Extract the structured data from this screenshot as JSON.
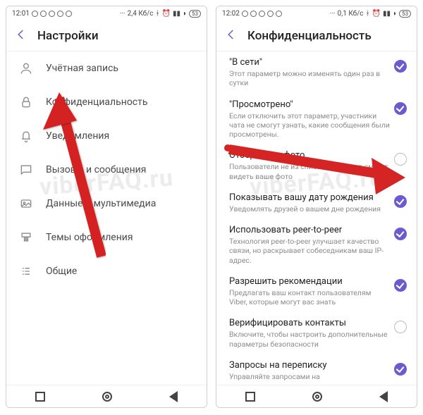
{
  "watermark": "viberFAQ.ru",
  "left": {
    "status": {
      "time": "12:01",
      "net": "2,4 Кб/с",
      "batt": "53"
    },
    "title": "Настройки",
    "items": [
      {
        "icon": "user-icon",
        "label": "Учётная запись"
      },
      {
        "icon": "lock-icon",
        "label": "Конфиденциальность"
      },
      {
        "icon": "bell-icon",
        "label": "Уведомления"
      },
      {
        "icon": "chat-icon",
        "label": "Вызовы и сообщения"
      },
      {
        "icon": "media-icon",
        "label": "Данные и мультимедиа"
      },
      {
        "icon": "brush-icon",
        "label": "Темы оформления"
      },
      {
        "icon": "list-icon",
        "label": "Общие"
      }
    ]
  },
  "right": {
    "status": {
      "time": "12:02",
      "net": "0,1 Кб/с",
      "batt": "53"
    },
    "title": "Конфиденциальность",
    "items": [
      {
        "title": "\"В сети\"",
        "desc": "Этот параметр можно изменять один раз в сутки",
        "checked": true
      },
      {
        "title": "\"Просмотрено\"",
        "desc": "Если отключить этот параметр, участники чата не смогут узнать, какие сообщения были просмотрены.",
        "checked": true
      },
      {
        "title": "Отображать фото",
        "desc": "Пользователи не из списка контактов смогут видеть ваше фото",
        "checked": false
      },
      {
        "title": "Показывать вашу дату рождения",
        "desc": "Уведомлять друзей о вашем дне рождения",
        "checked": true
      },
      {
        "title": "Использовать peer-to-peer",
        "desc": "Технология peer-to-peer улучшает качество связи, но раскрывает собеседникам ваш IP-адрес.",
        "checked": true
      },
      {
        "title": "Разрешить рекомендации",
        "desc": "Предлагать ваш контакт пользователям Viber, которые могут вас знать",
        "checked": true
      },
      {
        "title": "Верифицировать контакты",
        "desc": "Включите, чтобы настроить дополнительные параметры безопасности",
        "checked": false
      },
      {
        "title": "Запросы на переписку",
        "desc": "Управляйте запросами на",
        "checked": true
      }
    ]
  }
}
